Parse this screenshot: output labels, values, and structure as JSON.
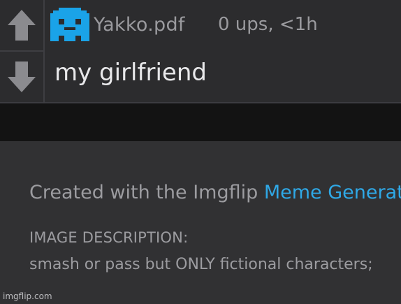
{
  "comment": {
    "username": "Yakko.pdf",
    "meta": "0 ups, <1h",
    "text": "my girlfriend",
    "avatar_color": "#1aa3e8"
  },
  "footer": {
    "created_prefix": "Created with the Imgflip ",
    "created_link": "Meme Generator",
    "description_label": "IMAGE DESCRIPTION:",
    "description_text": "smash or pass but ONLY fictional characters;"
  },
  "watermark": "imgflip.com",
  "icons": {
    "upvote": "arrow-up-icon",
    "downvote": "arrow-down-icon",
    "avatar": "pixel-ghost-avatar-icon"
  },
  "colors": {
    "link": "#2fa8e6",
    "arrow": "#8b8b8f"
  }
}
